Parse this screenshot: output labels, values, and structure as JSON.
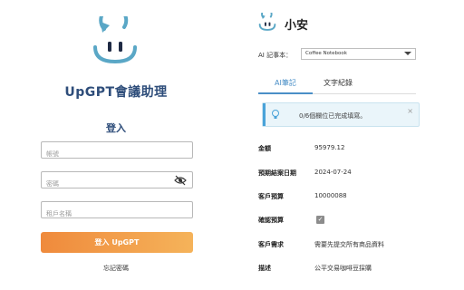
{
  "login": {
    "brand_name": "UpGPT會議助理",
    "title": "登入",
    "username_placeholder": "帳號",
    "password_placeholder": "密碼",
    "tenant_placeholder": "租戶名稱",
    "login_button": "登入 UpGPT",
    "forgot_link": "忘記密碼"
  },
  "assistant": {
    "name": "小安",
    "notebook_label": "AI 記事本：",
    "notebook_selected": "Coffee Notebook",
    "tabs": [
      {
        "label": "AI筆記",
        "active": true
      },
      {
        "label": "文字紀錄",
        "active": false
      }
    ],
    "alert_text": "0/6個欄位已完成填寫。",
    "alert_close": "×",
    "fields": [
      {
        "label": "金額",
        "value": "95979.12"
      },
      {
        "label": "預期結案日期",
        "value": "2024-07-24"
      },
      {
        "label": "客戶預算",
        "value": "10000088"
      },
      {
        "label": "確認預算",
        "value": "✓",
        "checked": true
      },
      {
        "label": "客戶需求",
        "value": "需要先提交所有商品資料"
      },
      {
        "label": "描述",
        "value": "公平交易咖啡豆採購"
      }
    ]
  },
  "colors": {
    "brand_blue": "#2e4d7a",
    "accent_blue": "#4a8fc7",
    "button_orange": "#ef8a3c",
    "logo_teal": "#5aa7c6"
  }
}
